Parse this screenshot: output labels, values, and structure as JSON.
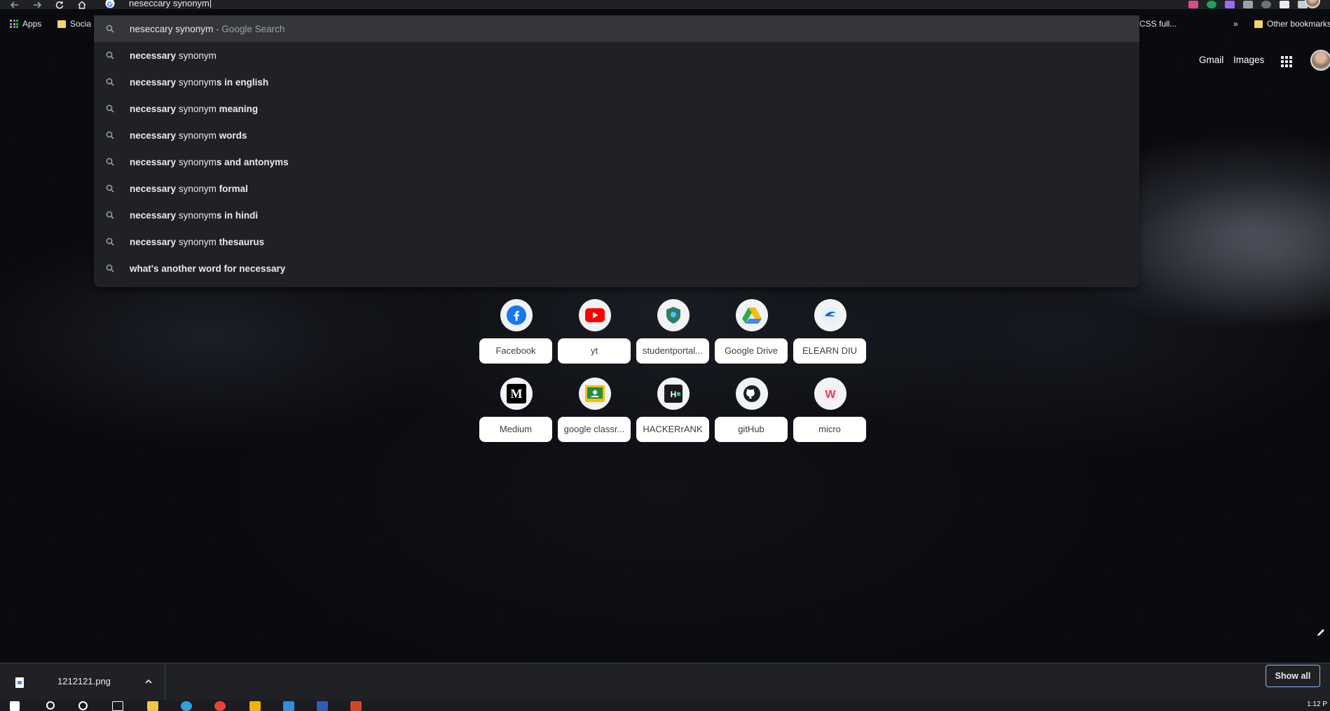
{
  "omnibox": {
    "query": "neseccary synonym"
  },
  "bookmarks": {
    "apps_label": "Apps",
    "social_label": "Socia",
    "css_label": "CSS full...",
    "more_label": "»",
    "other_label": "Other bookmarks"
  },
  "suggestions": [
    {
      "parts": [
        {
          "t": "neseccary synonym",
          "b": false
        },
        {
          "t": " - Google Search",
          "b": false,
          "muted": true
        }
      ]
    },
    {
      "parts": [
        {
          "t": "necessary",
          "b": true
        },
        {
          "t": " synonym",
          "b": false
        }
      ]
    },
    {
      "parts": [
        {
          "t": "necessary",
          "b": true
        },
        {
          "t": " synonym",
          "b": false
        },
        {
          "t": "s in english",
          "b": true
        }
      ]
    },
    {
      "parts": [
        {
          "t": "necessary",
          "b": true
        },
        {
          "t": " synonym ",
          "b": false
        },
        {
          "t": "meaning",
          "b": true
        }
      ]
    },
    {
      "parts": [
        {
          "t": "necessary",
          "b": true
        },
        {
          "t": " synonym ",
          "b": false
        },
        {
          "t": "words",
          "b": true
        }
      ]
    },
    {
      "parts": [
        {
          "t": "necessary",
          "b": true
        },
        {
          "t": " synonym",
          "b": false
        },
        {
          "t": "s and antonyms",
          "b": true
        }
      ]
    },
    {
      "parts": [
        {
          "t": "necessary",
          "b": true
        },
        {
          "t": " synonym ",
          "b": false
        },
        {
          "t": "formal",
          "b": true
        }
      ]
    },
    {
      "parts": [
        {
          "t": "necessary",
          "b": true
        },
        {
          "t": " synonym",
          "b": false
        },
        {
          "t": "s in hindi",
          "b": true
        }
      ]
    },
    {
      "parts": [
        {
          "t": "necessary",
          "b": true
        },
        {
          "t": " synonym ",
          "b": false
        },
        {
          "t": "thesaurus",
          "b": true
        }
      ]
    },
    {
      "parts": [
        {
          "t": "what's another word for necessary",
          "b": true
        }
      ]
    }
  ],
  "header": {
    "gmail": "Gmail",
    "images": "Images"
  },
  "shortcuts": [
    {
      "label": "Facebook",
      "icon": "facebook-icon"
    },
    {
      "label": "yt",
      "icon": "youtube-icon"
    },
    {
      "label": "studentportal...",
      "icon": "student-portal-icon"
    },
    {
      "label": "Google Drive",
      "icon": "google-drive-icon"
    },
    {
      "label": "ELEARN DIU",
      "icon": "elearn-icon"
    },
    {
      "label": "Medium",
      "icon": "medium-icon"
    },
    {
      "label": "google classr...",
      "icon": "google-classroom-icon"
    },
    {
      "label": "HACKERrANK",
      "icon": "hackerrank-icon"
    },
    {
      "label": "gitHub",
      "icon": "github-icon"
    },
    {
      "label": "micro",
      "icon": "micro-icon"
    }
  ],
  "downloads": {
    "file_name": "1212121.png",
    "show_all": "Show all"
  },
  "taskbar": {
    "clock": "1:12 P"
  },
  "colors": {
    "omnibox_bg": "#202124",
    "selected_bg": "#35363a",
    "accent": "#8ab4f8"
  }
}
